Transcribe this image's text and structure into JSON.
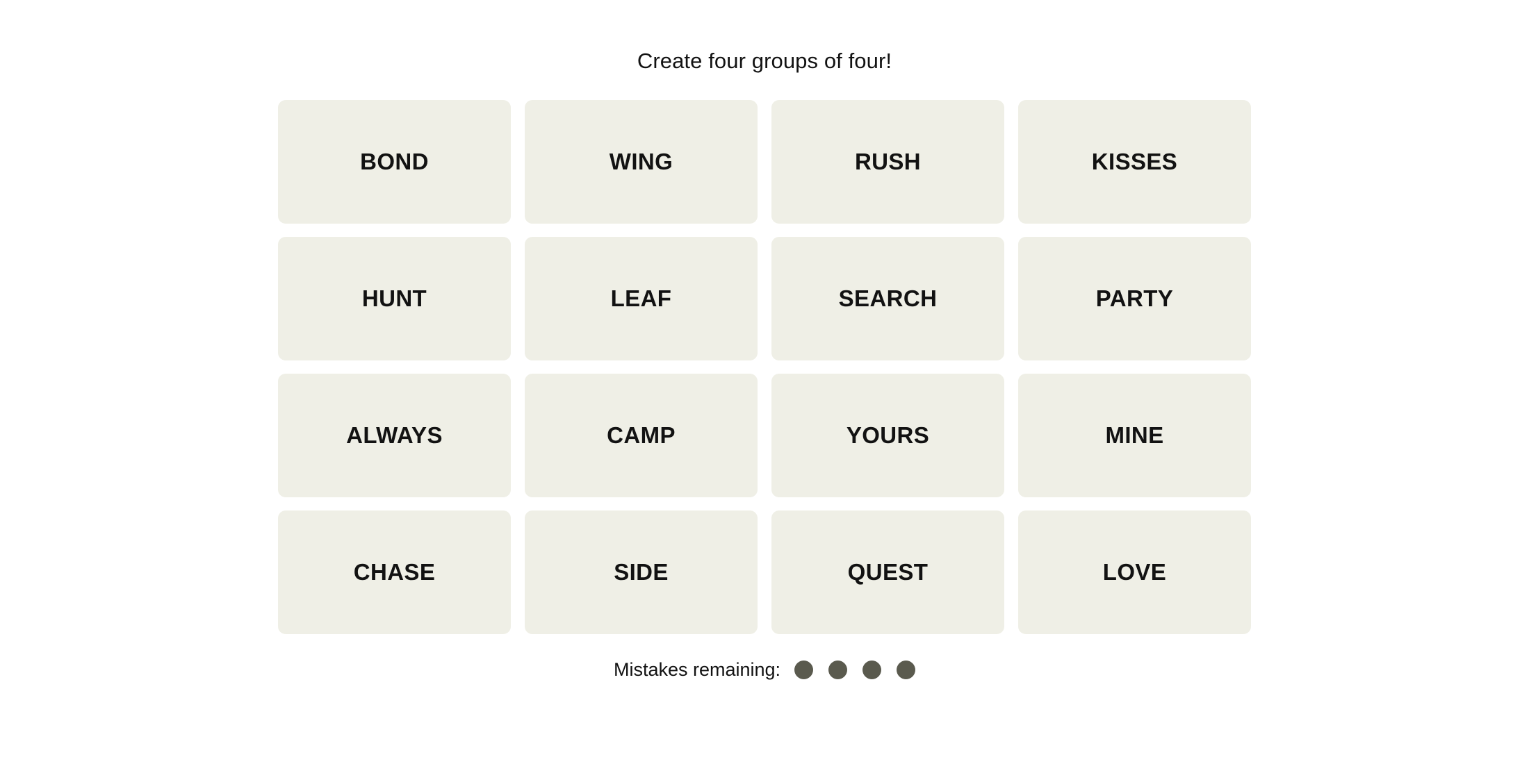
{
  "header": {
    "instruction": "Create four groups of four!"
  },
  "board": {
    "rows": 4,
    "columns": 4,
    "tiles": [
      {
        "label": "BOND",
        "row": 1,
        "col": 1
      },
      {
        "label": "WING",
        "row": 1,
        "col": 2
      },
      {
        "label": "RUSH",
        "row": 1,
        "col": 3
      },
      {
        "label": "KISSES",
        "row": 1,
        "col": 4
      },
      {
        "label": "HUNT",
        "row": 2,
        "col": 1
      },
      {
        "label": "LEAF",
        "row": 2,
        "col": 2
      },
      {
        "label": "SEARCH",
        "row": 2,
        "col": 3
      },
      {
        "label": "PARTY",
        "row": 2,
        "col": 4
      },
      {
        "label": "ALWAYS",
        "row": 3,
        "col": 1
      },
      {
        "label": "CAMP",
        "row": 3,
        "col": 2
      },
      {
        "label": "YOURS",
        "row": 3,
        "col": 3
      },
      {
        "label": "MINE",
        "row": 3,
        "col": 4
      },
      {
        "label": "CHASE",
        "row": 4,
        "col": 1
      },
      {
        "label": "SIDE",
        "row": 4,
        "col": 2
      },
      {
        "label": "QUEST",
        "row": 4,
        "col": 3
      },
      {
        "label": "LOVE",
        "row": 4,
        "col": 4
      }
    ]
  },
  "footer": {
    "mistakes_label": "Mistakes remaining:",
    "mistakes_remaining": 4,
    "dot_icon_name": "mistake-dot-icon"
  },
  "colors": {
    "page_background": "#FFFFFF",
    "tile_background": "#EFEFE6",
    "tile_text": "#121212",
    "instruction_text": "#121212",
    "mistake_dot": "#5A5A4E"
  }
}
